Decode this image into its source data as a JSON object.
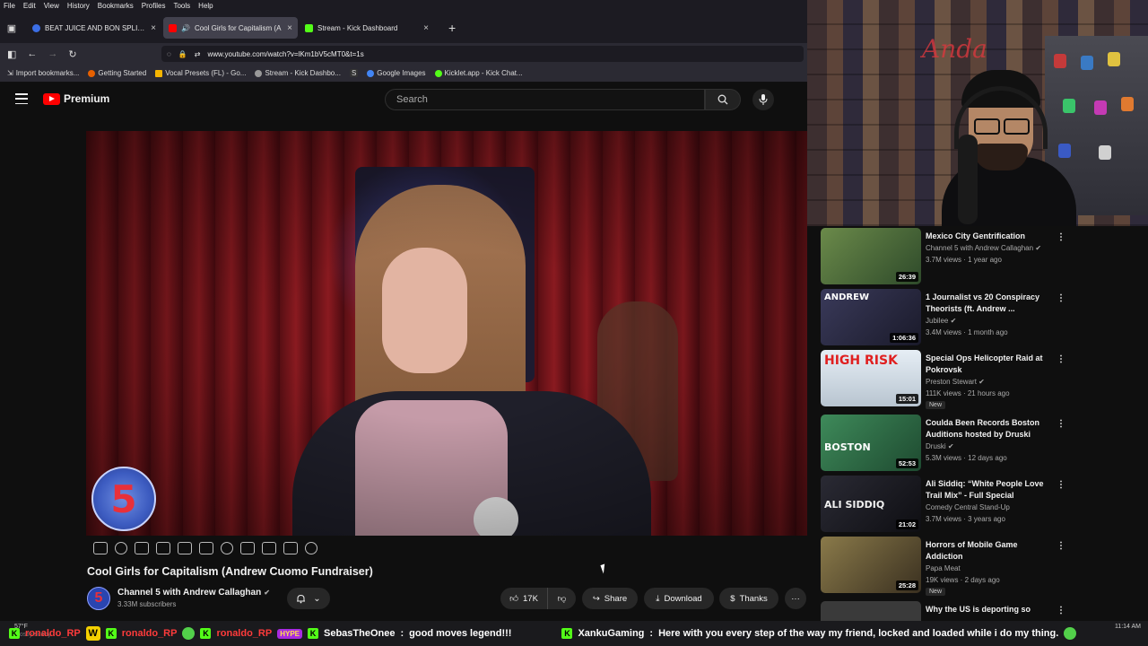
{
  "browser": {
    "menu": [
      "File",
      "Edit",
      "View",
      "History",
      "Bookmarks",
      "Profiles",
      "Tools",
      "Help"
    ],
    "tabs": [
      {
        "title": "BEAT JUICE AND BON SPLIFF - R",
        "favicon_color": "#3b6ee6",
        "active": false
      },
      {
        "title": "Cool Girls for Capitalism (A",
        "favicon_color": "#ff0000",
        "active": true
      },
      {
        "title": "Stream - Kick Dashboard",
        "favicon_color": "#53fc18",
        "active": false
      }
    ],
    "new_tab_icon": "+",
    "close_icon": "×",
    "url": "www.youtube.com/watch?v=lKm1bV5cMT0&t=1s",
    "bookmarks": [
      "Import bookmarks...",
      "Getting Started",
      "Vocal Presets (FL) - Go...",
      "Stream - Kick Dashbo...",
      "S",
      "Google Images",
      "Kicklet.app - Kick Chat..."
    ]
  },
  "youtube": {
    "logo_text": "Premium",
    "search_placeholder": "Search"
  },
  "video": {
    "channel_badge": "5",
    "title": "Cool Girls for Capitalism (Andrew Cuomo Fundraiser)",
    "channel_avatar": "5",
    "channel_name": "Channel 5 with Andrew Callaghan",
    "verified_icon": "✔",
    "subscribers": "3.33M subscribers",
    "likes": "17K",
    "share": "Share",
    "download": "Download",
    "thanks": "Thanks",
    "more": "···"
  },
  "webcam": {
    "wall_text": "Anda"
  },
  "recommendations": [
    {
      "title": "Mexico City Gentrification",
      "channel": "Channel 5 with Andrew Callaghan",
      "verified": true,
      "meta": "3.7M views · 1 year ago",
      "duration": "26:39",
      "badge": "",
      "thumb_color": "#4a6b3a",
      "thumb_text": "",
      "thumb_text_color": "#fff"
    },
    {
      "title": "1 Journalist vs 20 Conspiracy Theorists (ft. Andrew ...",
      "channel": "Jubilee",
      "verified": true,
      "meta": "3.4M views · 1 month ago",
      "duration": "1:06:36",
      "badge": "",
      "thumb_color": "#2a2a40",
      "thumb_text": "ANDREW",
      "thumb_text_color": "#fff"
    },
    {
      "title": "Special Ops Helicopter Raid at Pokrovsk",
      "channel": "Preston Stewart",
      "verified": true,
      "meta": "111K views · 21 hours ago",
      "duration": "15:01",
      "badge": "New",
      "thumb_color": "#cfd9e4",
      "thumb_text": "HIGH RISK",
      "thumb_text_color": "#e02020"
    },
    {
      "title": "Coulda Been Records Boston Auditions hosted by Druski",
      "channel": "Druski",
      "verified": true,
      "meta": "5.3M views · 12 days ago",
      "duration": "52:53",
      "badge": "",
      "thumb_color": "#2e6b4a",
      "thumb_text": "BOSTON",
      "thumb_text_color": "#fff"
    },
    {
      "title": "Ali Siddiq: “White People Love Trail Mix” - Full Special",
      "channel": "Comedy Central Stand-Up",
      "verified": false,
      "meta": "3.7M views · 3 years ago",
      "duration": "21:02",
      "badge": "",
      "thumb_color": "#1d1d24",
      "thumb_text": "ALI SIDDIQ",
      "thumb_text_color": "#f1f1f1"
    },
    {
      "title": "Horrors of Mobile Game Addiction",
      "channel": "Papa Meat",
      "verified": false,
      "meta": "19K views · 2 days ago",
      "duration": "25:28",
      "badge": "New",
      "thumb_color": "#6b5a3a",
      "thumb_text": "",
      "thumb_text_color": "#fff"
    },
    {
      "title": "Why the US is deporting so",
      "channel": "",
      "verified": false,
      "meta": "",
      "duration": "",
      "badge": "",
      "thumb_color": "#3a3a3a",
      "thumb_text": "",
      "thumb_text_color": "#fff"
    }
  ],
  "taskbar": {
    "weather_temp": "57°F",
    "weather_desc": "Mostly sunny",
    "clock_time": "11:14 AM"
  },
  "chat_ticker": [
    {
      "type": "user",
      "name": "ronaldo_RP",
      "color": "red"
    },
    {
      "type": "wbadge",
      "text": "W"
    },
    {
      "type": "user",
      "name": "ronaldo_RP",
      "color": "red"
    },
    {
      "type": "emote"
    },
    {
      "type": "user",
      "name": "ronaldo_RP",
      "color": "red"
    },
    {
      "type": "hype",
      "text": "HYPE"
    },
    {
      "type": "msg",
      "name": "SebasTheOnee",
      "text": "good moves legend!!!"
    },
    {
      "type": "msg",
      "name": "XankuGaming",
      "text": "Here with you every step of the way my friend, locked and loaded while i do my thing."
    }
  ]
}
